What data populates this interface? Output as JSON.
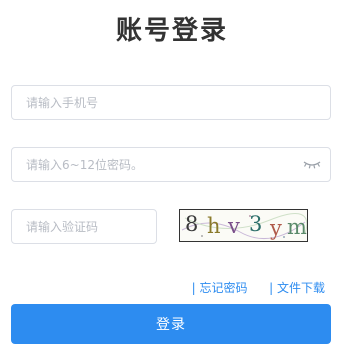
{
  "title": "账号登录",
  "phone": {
    "placeholder": "请输入手机号",
    "value": ""
  },
  "password": {
    "placeholder": "请输入6~12位密码。",
    "value": "",
    "toggle_icon": "eye-closed-icon"
  },
  "captcha": {
    "placeholder": "请输入验证码",
    "value": "",
    "image_text": "8hv3ym",
    "chars": [
      "8",
      "h",
      "v",
      "3",
      "y",
      "m"
    ],
    "char_colors": [
      "#3a3a3a",
      "#8a7a2a",
      "#7a4f8a",
      "#2d6f6a",
      "#b05a4a",
      "#5a8a6a"
    ]
  },
  "links": {
    "separator": "|",
    "forgot_password": "忘记密码",
    "file_download": "文件下载"
  },
  "login_button": "登录",
  "colors": {
    "primary": "#2d8cf0",
    "border": "#dcdfe6",
    "placeholder": "#b8bcc4",
    "title": "#333333"
  }
}
